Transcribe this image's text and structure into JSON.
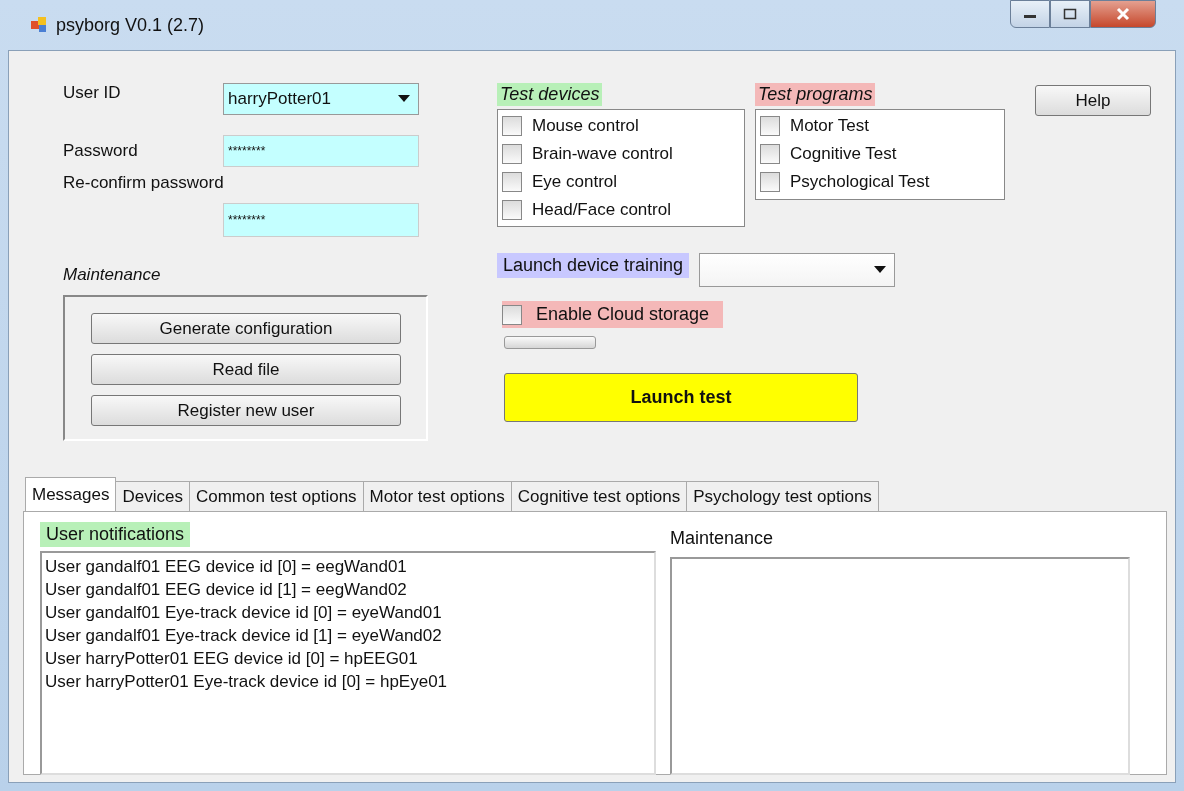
{
  "window": {
    "title": "psyborg V0.1 (2.7)"
  },
  "user_id": {
    "label": "User ID",
    "value": "harryPotter01"
  },
  "password": {
    "label": "Password",
    "value": "********"
  },
  "reconfirm": {
    "label": "Re-confirm password",
    "value": "********"
  },
  "maintenance": {
    "title": "Maintenance",
    "buttons": [
      "Generate configuration",
      "Read file",
      "Register new user"
    ]
  },
  "test_devices": {
    "title": "Test devices",
    "items": [
      {
        "label": "Mouse control",
        "checked": false
      },
      {
        "label": "Brain-wave control",
        "checked": false
      },
      {
        "label": "Eye control",
        "checked": false
      },
      {
        "label": "Head/Face control",
        "checked": false
      }
    ]
  },
  "test_programs": {
    "title": "Test programs",
    "items": [
      {
        "label": "Motor Test",
        "checked": false
      },
      {
        "label": "Cognitive Test",
        "checked": false
      },
      {
        "label": "Psychological Test",
        "checked": false
      }
    ]
  },
  "help_button": "Help",
  "device_training": {
    "label": "Launch device training"
  },
  "cloud_storage": {
    "label": "Enable Cloud storage",
    "checked": false
  },
  "progress": {
    "level": 0
  },
  "launch_button": "Launch test",
  "tabs": [
    {
      "label": "Messages",
      "selected": true
    },
    {
      "label": "Devices",
      "selected": false
    },
    {
      "label": "Common test options",
      "selected": false
    },
    {
      "label": "Motor test options",
      "selected": false
    },
    {
      "label": "Cognitive test options",
      "selected": false
    },
    {
      "label": "Psychology test options",
      "selected": false
    }
  ],
  "user_notifications": {
    "title": "User notifications",
    "lines": [
      "User gandalf01 EEG device id [0] = eegWand01",
      "User gandalf01 EEG device id [1] = eegWand02",
      "User gandalf01 Eye-track device id [0] = eyeWand01",
      "User gandalf01 Eye-track device id [1] = eyeWand02",
      "User harryPotter01 EEG device id [0] = hpEEG01",
      "User harryPotter01 Eye-track device id [0] = hpEye01"
    ]
  },
  "maintenance_log": {
    "title": "Maintenance"
  }
}
